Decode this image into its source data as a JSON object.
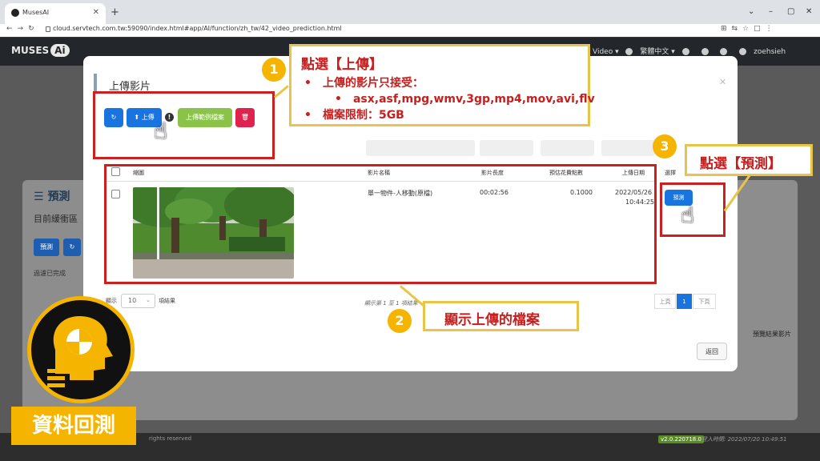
{
  "browser": {
    "tab_title": "MusesAI",
    "url": "cloud.servtech.com.tw:59090/index.html#app/AI/function/zh_tw/42_video_prediction.html"
  },
  "app": {
    "logo_text": "MUSES",
    "logo_ai": "Ai",
    "header_video": "Video ▾",
    "header_lang": "繁體中文 ▾",
    "header_user": "zoehsieh"
  },
  "background_page": {
    "title": "預測",
    "subtitle": "目前緩衝區",
    "predict_btn": "預測",
    "done_label": "過濾已完成",
    "result_col": "預覽結果影片",
    "copyright": "rights reserved",
    "version": "v2.0.220718.0",
    "login_time": "登入時間: 2022/07/20 10:49:51"
  },
  "modal": {
    "title": "上傳影片",
    "toolbar": {
      "upload_label": "上傳",
      "sample_label": "上傳範例檔案",
      "info": "!"
    },
    "table": {
      "headers": [
        "縮圖",
        "影片名稱",
        "影片長度",
        "預估花費點數",
        "上傳日期",
        "選擇"
      ],
      "rows": [
        {
          "name": "單一物件-人移動(原檔)",
          "length": "00:02:56",
          "points": "0.1000",
          "date": "2022/05/26",
          "time": "10:44:25",
          "action": "預測"
        }
      ]
    },
    "show_label": "顯示",
    "page_len": "10",
    "entries_label": "項結果",
    "page_info": "顯示第 1 至 1 項結果",
    "pagination": {
      "prev": "上頁",
      "current": "1",
      "next": "下頁"
    },
    "back_label": "返回"
  },
  "annotations": {
    "step1_num": "1",
    "step1_title": "點選【上傳】",
    "step1_line1": "上傳的影片只接受：",
    "step1_formats": "asx,asf,mpg,wmv,3gp,mp4,mov,avi,flv",
    "step1_line2": "檔案限制：5GB",
    "step2_num": "2",
    "step2_title": "顯示上傳的檔案",
    "step3_num": "3",
    "step3_title": "點選【預測】"
  },
  "badge": {
    "label": "資料回測"
  },
  "colors": {
    "accent_yellow": "#f4b400",
    "annotation_red": "#cc1f1f",
    "primary_blue": "#1a74e0",
    "sample_green": "#8bc34a",
    "delete_red": "#e0234e"
  }
}
